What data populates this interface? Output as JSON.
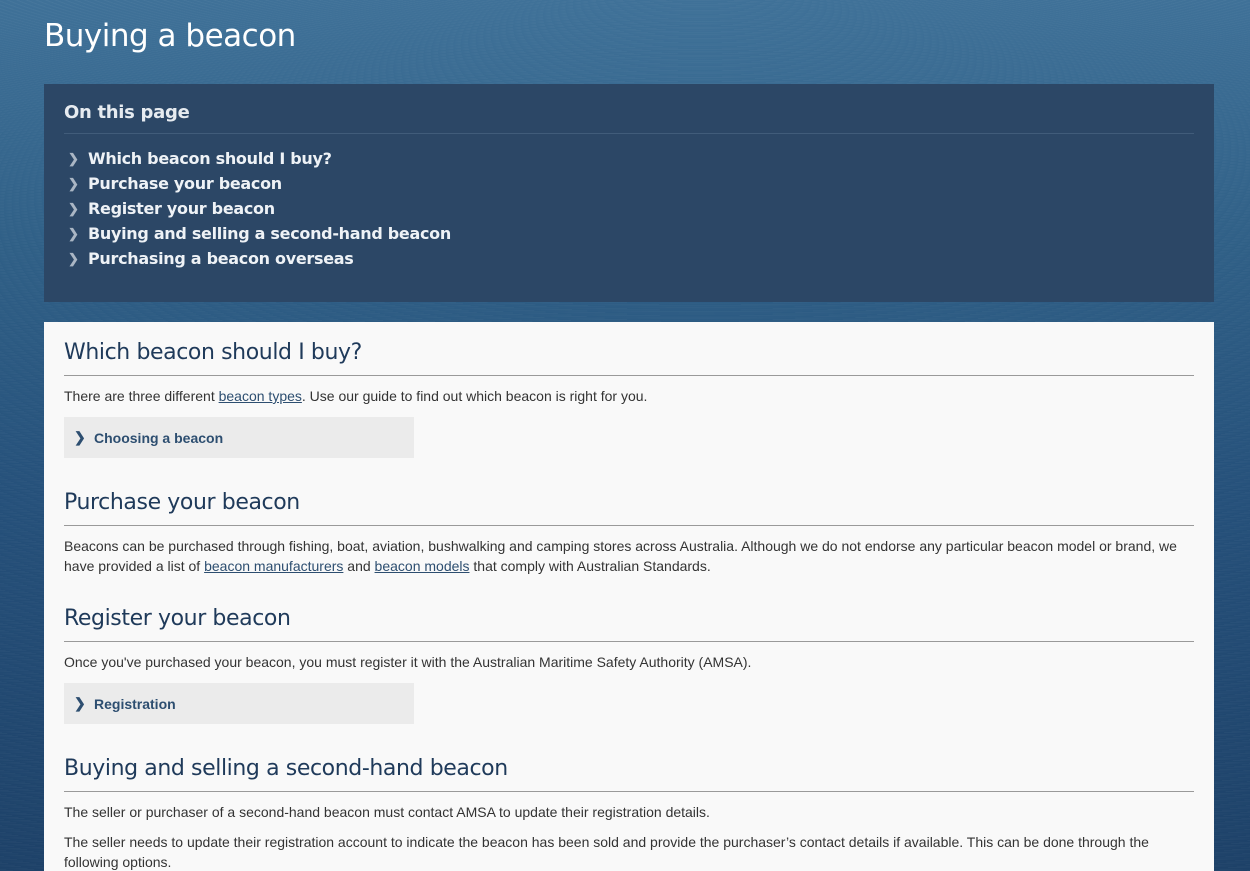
{
  "page": {
    "title": "Buying a beacon"
  },
  "toc": {
    "title": "On this page",
    "items": [
      {
        "label": "Which beacon should I buy?"
      },
      {
        "label": "Purchase your beacon"
      },
      {
        "label": "Register your beacon"
      },
      {
        "label": "Buying and selling a second-hand beacon"
      },
      {
        "label": "Purchasing a beacon overseas"
      }
    ]
  },
  "sections": {
    "which": {
      "heading": "Which beacon should I buy?",
      "text_before": "There are three different ",
      "link": "beacon types",
      "text_after": ". Use our guide to find out which beacon is right for you.",
      "accordion": "Choosing a beacon"
    },
    "purchase": {
      "heading": "Purchase your beacon",
      "text_before": "Beacons can be purchased through fishing, boat, aviation, bushwalking and camping stores across Australia. Although we do not endorse any particular beacon model or brand, we have provided a list of ",
      "link1": "beacon manufacturers",
      "text_mid": " and ",
      "link2": "beacon models",
      "text_after": " that comply with Australian Standards."
    },
    "register": {
      "heading": "Register your beacon",
      "text": "Once you've purchased your beacon, you must register it with the Australian Maritime Safety Authority (AMSA).",
      "accordion": "Registration"
    },
    "secondhand": {
      "heading": "Buying and selling a second-hand beacon",
      "para1": "The seller or purchaser of a second-hand beacon must contact AMSA to update their registration details.",
      "para2": "The seller needs to update their registration account to indicate the beacon has been sold and provide the purchaser’s contact details if available. This can be done through the following options."
    }
  },
  "icons": {
    "chevron": "chevron-right-icon"
  },
  "colors": {
    "toc_background": "#2c4766",
    "content_background": "#f9f9f9",
    "heading": "#1f3a5a",
    "link": "#2d4e70",
    "accordion_background": "#ebebeb"
  }
}
